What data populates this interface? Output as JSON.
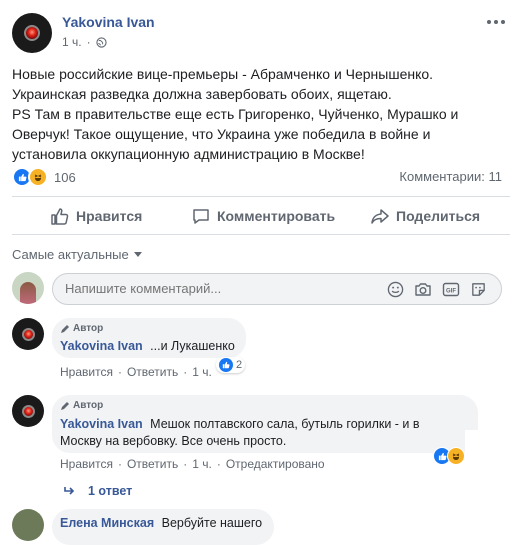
{
  "post": {
    "author": "Yakovina Ivan",
    "time": "1 ч.",
    "more_icon": "more-icon",
    "text_lines": [
      "Новые российские вице-премьеры - Абрамченко и Чернышенко.",
      "Украинская разведка должна завербовать обоих, ящетаю.",
      "PS Там в правительстве еще есть Григоренко, Чуйченко, Мурашко и",
      "Оверчук! Такое ощущение, что Украина уже победила в войне и",
      "установила оккупационную администрацию в Москве!"
    ],
    "reactions_count": "106",
    "comments_count": "Комментарии: 11"
  },
  "actions": {
    "like": "Нравится",
    "comment": "Комментировать",
    "share": "Поделиться"
  },
  "sort": {
    "label": "Самые актуальные"
  },
  "composer": {
    "placeholder": "Напишите комментарий..."
  },
  "comments": [
    {
      "badge": "Автор",
      "author": "Yakovina Ivan",
      "text": "...и Лукашенко",
      "reactions": "2",
      "links": {
        "like": "Нравится",
        "reply": "Ответить",
        "time": "1 ч."
      }
    },
    {
      "badge": "Автор",
      "author": "Yakovina Ivan",
      "text_line1": "Мешок полтавского сала, бутыль горилки - и в",
      "text_line2": "Москву на вербовку. Все очень просто.",
      "links": {
        "like": "Нравится",
        "reply": "Ответить",
        "time": "1 ч.",
        "edited": "Отредактировано"
      },
      "replies": "1 ответ"
    },
    {
      "author": "Елена Минская",
      "text": "Вербуйте нашего"
    }
  ],
  "colors": {
    "accent": "#385898",
    "like_blue": "#1877f2",
    "haha_yellow": "#f7b125"
  }
}
